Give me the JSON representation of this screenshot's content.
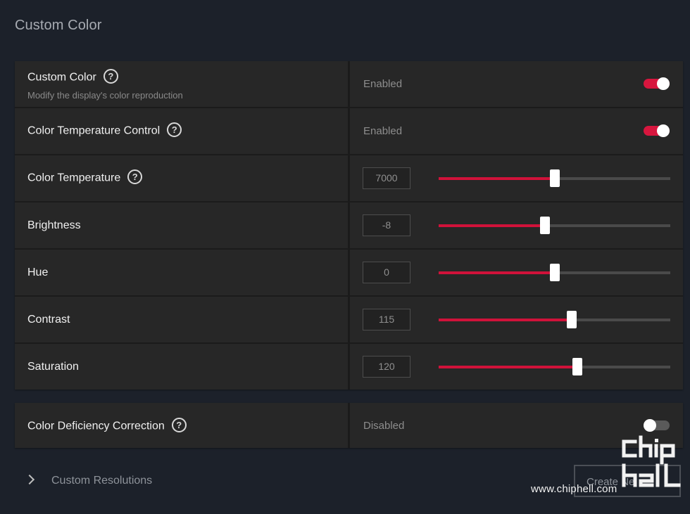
{
  "page": {
    "title": "Custom Color"
  },
  "panel_main": {
    "rows": [
      {
        "label": "Custom Color",
        "sublabel": "Modify the display's color reproduction",
        "status": "Enabled",
        "toggle": true
      },
      {
        "label": "Color Temperature Control",
        "status": "Enabled",
        "toggle": true
      },
      {
        "label": "Color Temperature",
        "value": "7000",
        "slider_fraction": 0.5
      },
      {
        "label": "Brightness",
        "value": "-8",
        "slider_fraction": 0.46
      },
      {
        "label": "Hue",
        "value": "0",
        "slider_fraction": 0.5
      },
      {
        "label": "Contrast",
        "value": "115",
        "slider_fraction": 0.575
      },
      {
        "label": "Saturation",
        "value": "120",
        "slider_fraction": 0.6
      }
    ]
  },
  "panel_deficiency": {
    "label": "Color Deficiency Correction",
    "status": "Disabled",
    "toggle": false
  },
  "footer": {
    "section_label": "Custom Resolutions",
    "create_button_label": "Create Ne"
  },
  "watermark": {
    "url": "www.chiphell.com",
    "logo": "chiphell-logo"
  },
  "colors": {
    "accent": "#d0123a",
    "background": "#1c212a",
    "row_background": "#272727"
  },
  "icons": {
    "help": "help-icon",
    "chevron": "chevron-right-icon"
  }
}
